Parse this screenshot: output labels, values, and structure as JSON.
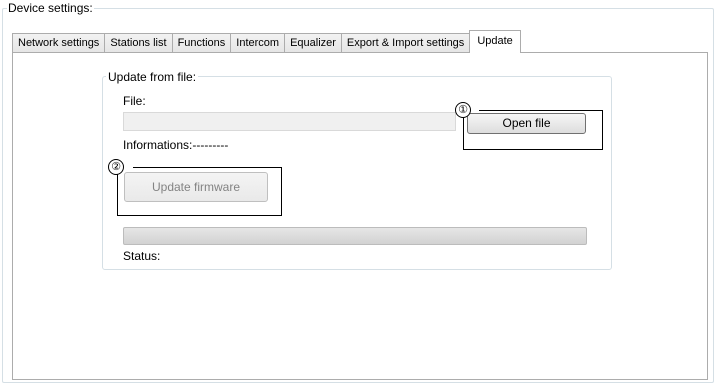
{
  "group": {
    "title": "Device settings:"
  },
  "tabs": [
    {
      "label": "Network settings",
      "active": false
    },
    {
      "label": "Stations list",
      "active": false
    },
    {
      "label": "Functions",
      "active": false
    },
    {
      "label": "Intercom",
      "active": false
    },
    {
      "label": "Equalizer",
      "active": false
    },
    {
      "label": "Export & Import settings",
      "active": false
    },
    {
      "label": "Update",
      "active": true
    }
  ],
  "update_from_file": {
    "title": "Update from file:",
    "file_label": "File:",
    "file_value": "",
    "open_file_button": "Open file",
    "informations_label": "Informations:---------",
    "update_firmware_button": "Update firmware",
    "update_firmware_enabled": false,
    "progress_fraction": 0,
    "status_label": "Status:"
  },
  "callouts": {
    "one": "①",
    "two": "②"
  }
}
